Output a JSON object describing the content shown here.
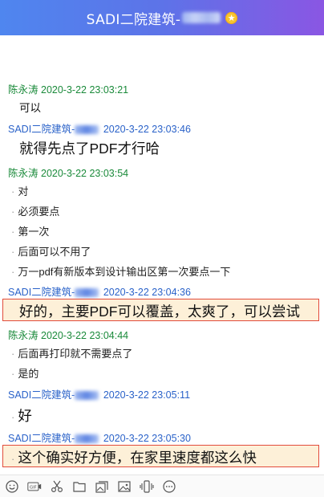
{
  "window": {
    "title_prefix": "SADI二院建筑-",
    "star_glyph": "★"
  },
  "messages": [
    {
      "sender": "陈永涛",
      "time": "2020-3-22 23:03:21",
      "sender_color": "green",
      "lines": [
        "可以"
      ]
    },
    {
      "sender": "SADI二院建筑-",
      "time": "2020-3-22 23:03:46",
      "sender_color": "blue",
      "lines": [
        "就得先点了PDF才行哈"
      ]
    },
    {
      "sender": "陈永涛",
      "time": "2020-3-22 23:03:54",
      "sender_color": "green",
      "lines": [
        "对",
        "必须要点",
        "第一次",
        "后面可以不用了",
        "万一pdf有新版本到设计输出区第一次要点一下"
      ]
    },
    {
      "sender": "SADI二院建筑-",
      "time": "2020-3-22 23:04:36",
      "sender_color": "blue",
      "lines": [
        "好的，主要PDF可以覆盖，太爽了，可以尝试"
      ]
    },
    {
      "sender": "陈永涛",
      "time": "2020-3-22 23:04:44",
      "sender_color": "green",
      "lines": [
        "后面再打印就不需要点了",
        "是的"
      ]
    },
    {
      "sender": "SADI二院建筑-",
      "time": "2020-3-22 23:05:11",
      "sender_color": "blue",
      "lines": [
        "好"
      ]
    },
    {
      "sender": "SADI二院建筑-",
      "time": "2020-3-22 23:05:30",
      "sender_color": "blue",
      "lines": [
        "这个确实好方便，在家里速度都这么快"
      ]
    }
  ],
  "toolbar": {
    "icons": [
      "emoji-icon",
      "gif-icon",
      "scissors-icon",
      "folder-icon",
      "image-gallery-icon",
      "picture-icon",
      "shake-icon",
      "more-icon"
    ],
    "gif_label": "GIF"
  },
  "colors": {
    "titlebar_left": "#4f86ef",
    "titlebar_right": "#8a56e3",
    "sender_green": "#1a8a3a",
    "sender_blue": "#2a62c9",
    "highlight_bg": "#fdf0d8",
    "highlight_border": "#e24c3c"
  }
}
